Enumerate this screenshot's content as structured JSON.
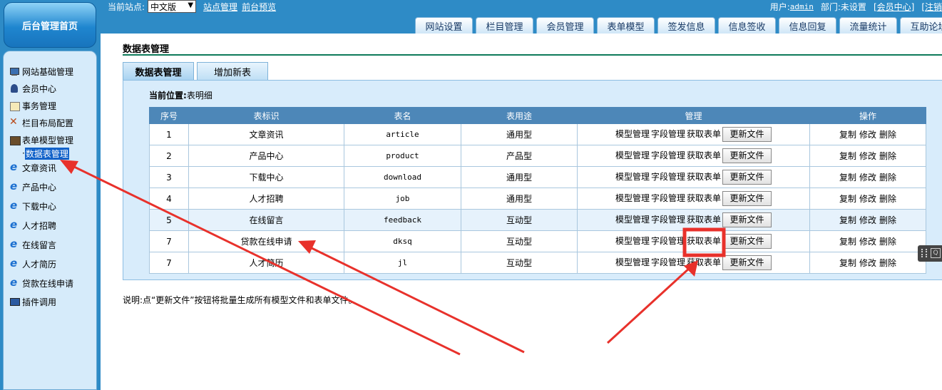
{
  "header": {
    "home_label": "后台管理首页",
    "site_label": "当前站点:",
    "site_value": "中文版",
    "links": [
      "站点管理",
      "前台预览"
    ],
    "user_label": "用户:",
    "user_name": "admin",
    "dept": "部门:未设置",
    "member_center": "[会员中心]",
    "logout": "[注销"
  },
  "nav_tabs": [
    "网站设置",
    "栏目管理",
    "会员管理",
    "表单模型",
    "签发信息",
    "信息签收",
    "信息回复",
    "流量统计",
    "互助论坛"
  ],
  "sidebar": {
    "items": [
      {
        "label": "网站基础管理",
        "icon": "computer-icon"
      },
      {
        "label": "会员中心",
        "icon": "user-icon"
      },
      {
        "label": "事务管理",
        "icon": "document-icon"
      },
      {
        "label": "栏目布局配置",
        "icon": "tools-icon"
      },
      {
        "label": "表单模型管理",
        "icon": "book-icon"
      }
    ],
    "sub_item": "数据表管理",
    "ie_items": [
      "文章资讯",
      "产品中心",
      "下载中心",
      "人才招聘",
      "在线留言",
      "人才简历",
      "贷款在线申请"
    ],
    "plugin_item": "插件调用"
  },
  "page": {
    "title": "数据表管理",
    "tabs": [
      "数据表管理",
      "增加新表"
    ],
    "crumb_label": "当前位置:",
    "crumb_value": "表明细",
    "note": "说明:点“更新文件”按钮将批量生成所有模型文件和表单文件。"
  },
  "table": {
    "headers": [
      "序号",
      "表标识",
      "表名",
      "表用途",
      "管理",
      "操作"
    ],
    "manage_links": [
      "模型管理",
      "字段管理",
      "获取表单"
    ],
    "update_button": "更新文件",
    "ops": [
      "复制",
      "修改",
      "删除"
    ],
    "rows": [
      {
        "no": "1",
        "label": "文章资讯",
        "name": "article",
        "usage": "通用型"
      },
      {
        "no": "2",
        "label": "产品中心",
        "name": "product",
        "usage": "产品型"
      },
      {
        "no": "3",
        "label": "下载中心",
        "name": "download",
        "usage": "通用型"
      },
      {
        "no": "4",
        "label": "人才招聘",
        "name": "job",
        "usage": "通用型"
      },
      {
        "no": "5",
        "label": "在线留言",
        "name": "feedback",
        "usage": "互动型"
      },
      {
        "no": "7",
        "label": "贷款在线申请",
        "name": "dksq",
        "usage": "互动型"
      },
      {
        "no": "7",
        "label": "人才简历",
        "name": "jl",
        "usage": "互动型"
      }
    ]
  },
  "colors": {
    "topbar": "#2e8bc6",
    "sidebar_bg": "#d6ebfa",
    "table_header": "#4d87b8",
    "annotation_red": "#e8312b"
  }
}
